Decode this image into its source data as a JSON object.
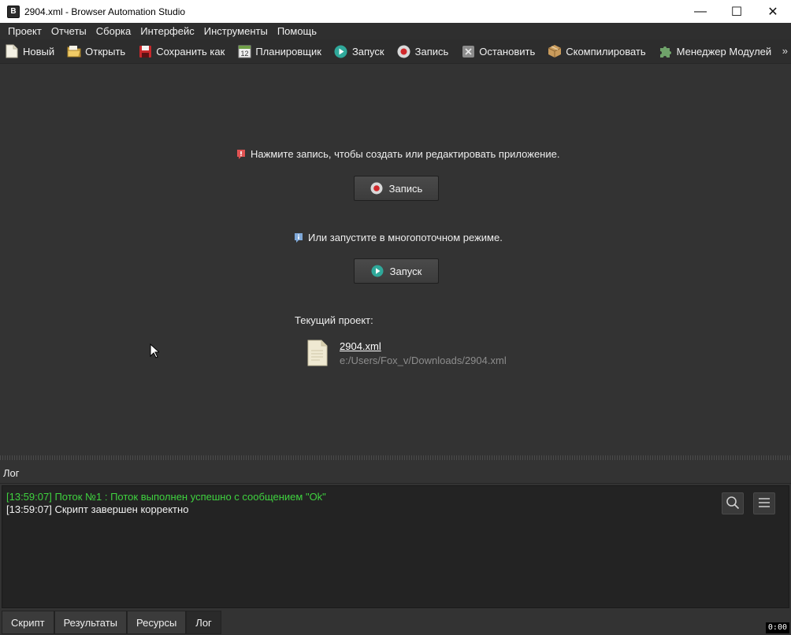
{
  "window": {
    "title": "2904.xml - Browser Automation Studio",
    "app_icon_letter": "B",
    "minimize_glyph": "—",
    "maximize_glyph": "☐",
    "close_glyph": "✕"
  },
  "menu": {
    "items": [
      "Проект",
      "Отчеты",
      "Сборка",
      "Интерфейс",
      "Инструменты",
      "Помощь"
    ]
  },
  "toolbar": {
    "buttons": [
      {
        "label": "Новый",
        "icon": "new-file-icon"
      },
      {
        "label": "Открыть",
        "icon": "open-folder-icon"
      },
      {
        "label": "Сохранить как",
        "icon": "save-icon"
      },
      {
        "label": "Планировщик",
        "icon": "calendar-icon"
      },
      {
        "label": "Запуск",
        "icon": "play-icon"
      },
      {
        "label": "Запись",
        "icon": "record-icon"
      },
      {
        "label": "Остановить",
        "icon": "stop-icon"
      },
      {
        "label": "Скомпилировать",
        "icon": "package-icon"
      },
      {
        "label": "Менеджер Модулей",
        "icon": "puzzle-icon"
      }
    ],
    "calendar_day": "12",
    "more": "»"
  },
  "main": {
    "record_hint": "Нажмите запись, чтобы создать или редактировать приложение.",
    "record_button": "Запись",
    "run_hint": "Или запустите в многопоточном режиме.",
    "run_button": "Запуск",
    "current_project_label": "Текущий проект:",
    "project_file": "2904.xml",
    "project_path": "e:/Users/Fox_v/Downloads/2904.xml"
  },
  "log": {
    "title": "Лог",
    "lines": [
      {
        "text": "[13:59:07] Поток №1 : Поток выполнен успешно с сообщением \"Ok\"",
        "color": "#3fd23f"
      },
      {
        "text": "[13:59:07] Скрипт завершен корректно",
        "color": "#f0f0f0"
      }
    ]
  },
  "tabs": {
    "items": [
      "Скрипт",
      "Результаты",
      "Ресурсы",
      "Лог"
    ],
    "active": "Лог"
  },
  "timer": "0:00"
}
